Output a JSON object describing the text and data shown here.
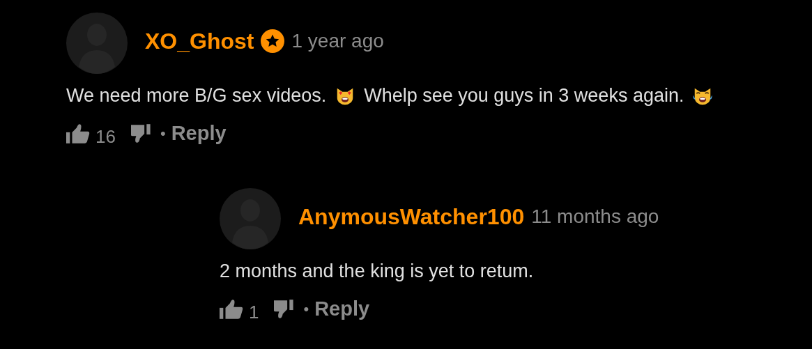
{
  "comments": [
    {
      "author": "XO_Ghost",
      "starred": true,
      "time": "1 year ago",
      "body": [
        {
          "kind": "text",
          "text": "We need more B/G sex videos."
        },
        {
          "kind": "heart_eyes_cat"
        },
        {
          "kind": "text",
          "text": "Whelp see you guys in 3 weeks again."
        },
        {
          "kind": "joy_cat"
        }
      ],
      "likes": "16",
      "separator": "•",
      "reply_label": "Reply",
      "replies": [
        {
          "author": "AnymousWatcher100",
          "starred": false,
          "time": "11 months ago",
          "body": [
            {
              "kind": "text",
              "text": "2 months and the king is yet to retum."
            }
          ],
          "likes": "1",
          "separator": "•",
          "reply_label": "Reply"
        }
      ]
    }
  ]
}
